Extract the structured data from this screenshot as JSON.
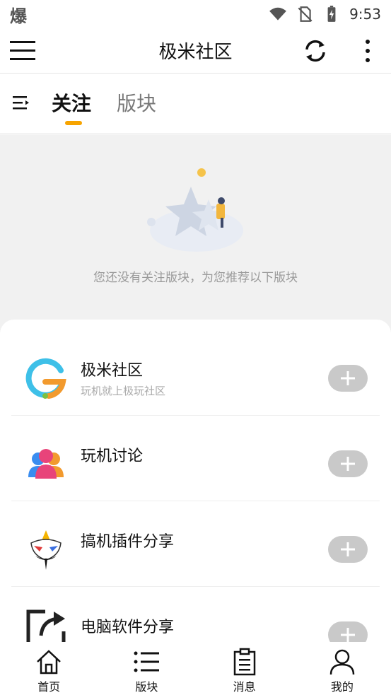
{
  "status_bar": {
    "left_glyph": "爆",
    "time": "9:53",
    "icons": [
      "wifi-icon",
      "no-sim-icon",
      "battery-charging-icon"
    ]
  },
  "app_bar": {
    "title": "极米社区",
    "icons": [
      "hamburger-menu-icon",
      "sync-icon",
      "more-vertical-icon"
    ]
  },
  "tabs": {
    "items": [
      {
        "label": "关注",
        "active": true
      },
      {
        "label": "版块",
        "active": false
      }
    ],
    "indicator_color": "#f7a400",
    "icon": "sort-filter-icon"
  },
  "empty_state": {
    "message": "您还没有关注版块，为您推荐以下版块",
    "illustration": "star-empty-illustration"
  },
  "recommend": {
    "boards": [
      {
        "name": "极米社区",
        "description": "玩机就上极玩社区",
        "logo": "g-logo"
      },
      {
        "name": "玩机讨论",
        "description": "",
        "logo": "people-group-logo"
      },
      {
        "name": "搞机插件分享",
        "description": "",
        "logo": "opera-mask-logo"
      },
      {
        "name": "电脑软件分享",
        "description": "",
        "logo": "share-box-logo"
      }
    ],
    "follow_button_icon": "plus-icon"
  },
  "bottom_nav": {
    "items": [
      {
        "label": "首页",
        "icon": "home-icon"
      },
      {
        "label": "版块",
        "icon": "list-icon"
      },
      {
        "label": "消息",
        "icon": "clipboard-icon"
      },
      {
        "label": "我的",
        "icon": "person-icon"
      }
    ]
  }
}
